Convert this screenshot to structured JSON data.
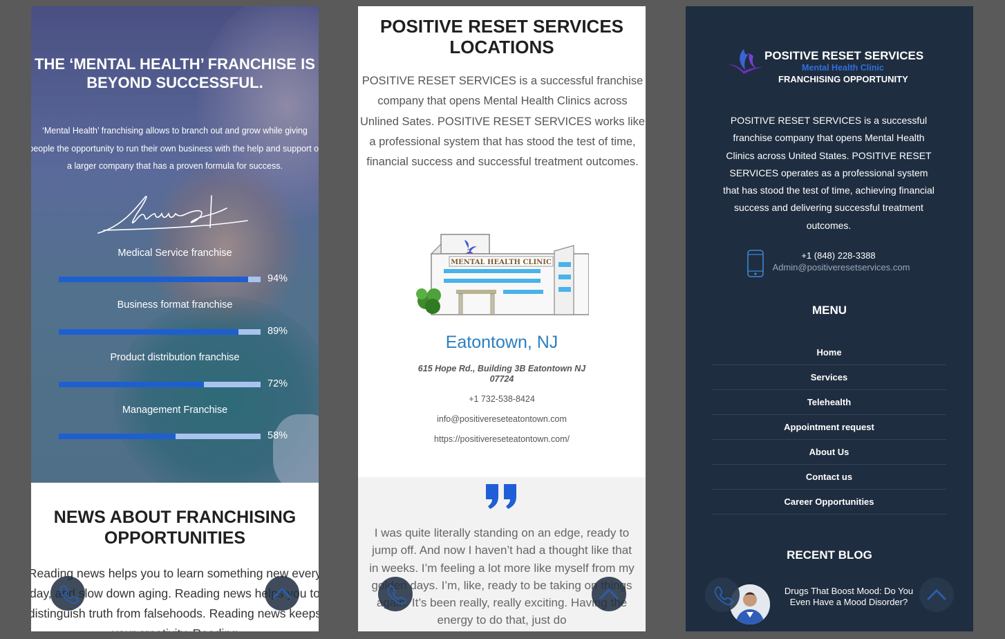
{
  "panel1": {
    "title": "THE ‘MENTAL HEALTH’ FRANCHISE IS BEYOND SUCCESSFUL.",
    "text": "‘Mental Health’ franchising allows to branch out and grow while giving people the opportunity to run their own business with the help and support of a larger company that has a proven formula for success.",
    "skills": [
      {
        "label": "Medical Service franchise",
        "percent": 94,
        "percent_label": "94%"
      },
      {
        "label": "Business format franchise",
        "percent": 89,
        "percent_label": "89%"
      },
      {
        "label": "Product distribution franchise",
        "percent": 72,
        "percent_label": "72%"
      },
      {
        "label": "Management Franchise",
        "percent": 58,
        "percent_label": "58%"
      }
    ],
    "news_title": "NEWS ABOUT FRANCHISING OPPORTUNITIES",
    "news_text": "Reading news helps you to learn something new every day, and slow down aging. Reading news helps you to distinguish truth from falsehoods. Reading news keeps your creativity. Reading"
  },
  "panel2": {
    "title": "POSITIVE RESET SERVICES LOCATIONS",
    "description": "POSITIVE RESET SERVICES is a successful franchise company that opens Mental Health Clinics across Unlined Sates. POSITIVE RESET SERVICES works like a professional system that has stood the test of time, financial success and successful treatment outcomes.",
    "clinic_sign": "MENTAL HEALTH CLINIC",
    "city": "Eatontown, NJ",
    "address": "615 Hope Rd., Building 3B Eatontown NJ 07724",
    "phone": "+1 732-538-8424",
    "email": "info@positivereseteatontown.com",
    "website": "https://positivereseteatontown.com/",
    "testimonial": "I was quite literally standing on an edge, ready to jump off. And now I haven’t had a thought like that in weeks. I’m feeling a lot more like myself from my golden days. I’m, like, ready to be taking on things again. It’s been really, really exciting. Having the energy to do that, just do"
  },
  "panel3": {
    "brand_name": "POSITIVE RESET SERVICES",
    "brand_sub": "Mental Health Clinic",
    "brand_tagline": "FRANCHISING OPPORTUNITY",
    "about": "POSITIVE RESET SERVICES is a successful franchise company that opens Mental Health Clinics across United States. POSITIVE RESET SERVICES operates as a professional system that has stood the test of time, achieving financial success and delivering successful treatment outcomes.",
    "phone": "+1 (848) 228-3388",
    "email": "Admin@positiveresetservices.com",
    "menu_title": "MENU",
    "menu": [
      "Home",
      "Services",
      "Telehealth",
      "Appointment request",
      "About Us",
      "Contact us",
      "Career Opportunities"
    ],
    "recent_blog_title": "RECENT BLOG",
    "blog_post_title": "Drugs That Boost Mood: Do You Even Have a Mood Disorder?"
  },
  "colors": {
    "navy_footer": "#1f2d40",
    "accent_blue": "#2a7fc1",
    "progress_fill": "#1e5fd0",
    "progress_track": "#a9c3ef",
    "brand_purple": "#6a3fc8"
  },
  "icons": [
    "phone-icon",
    "chevron-up-icon",
    "quote-icon",
    "logo-bird-icon",
    "mobile-phone-icon"
  ]
}
